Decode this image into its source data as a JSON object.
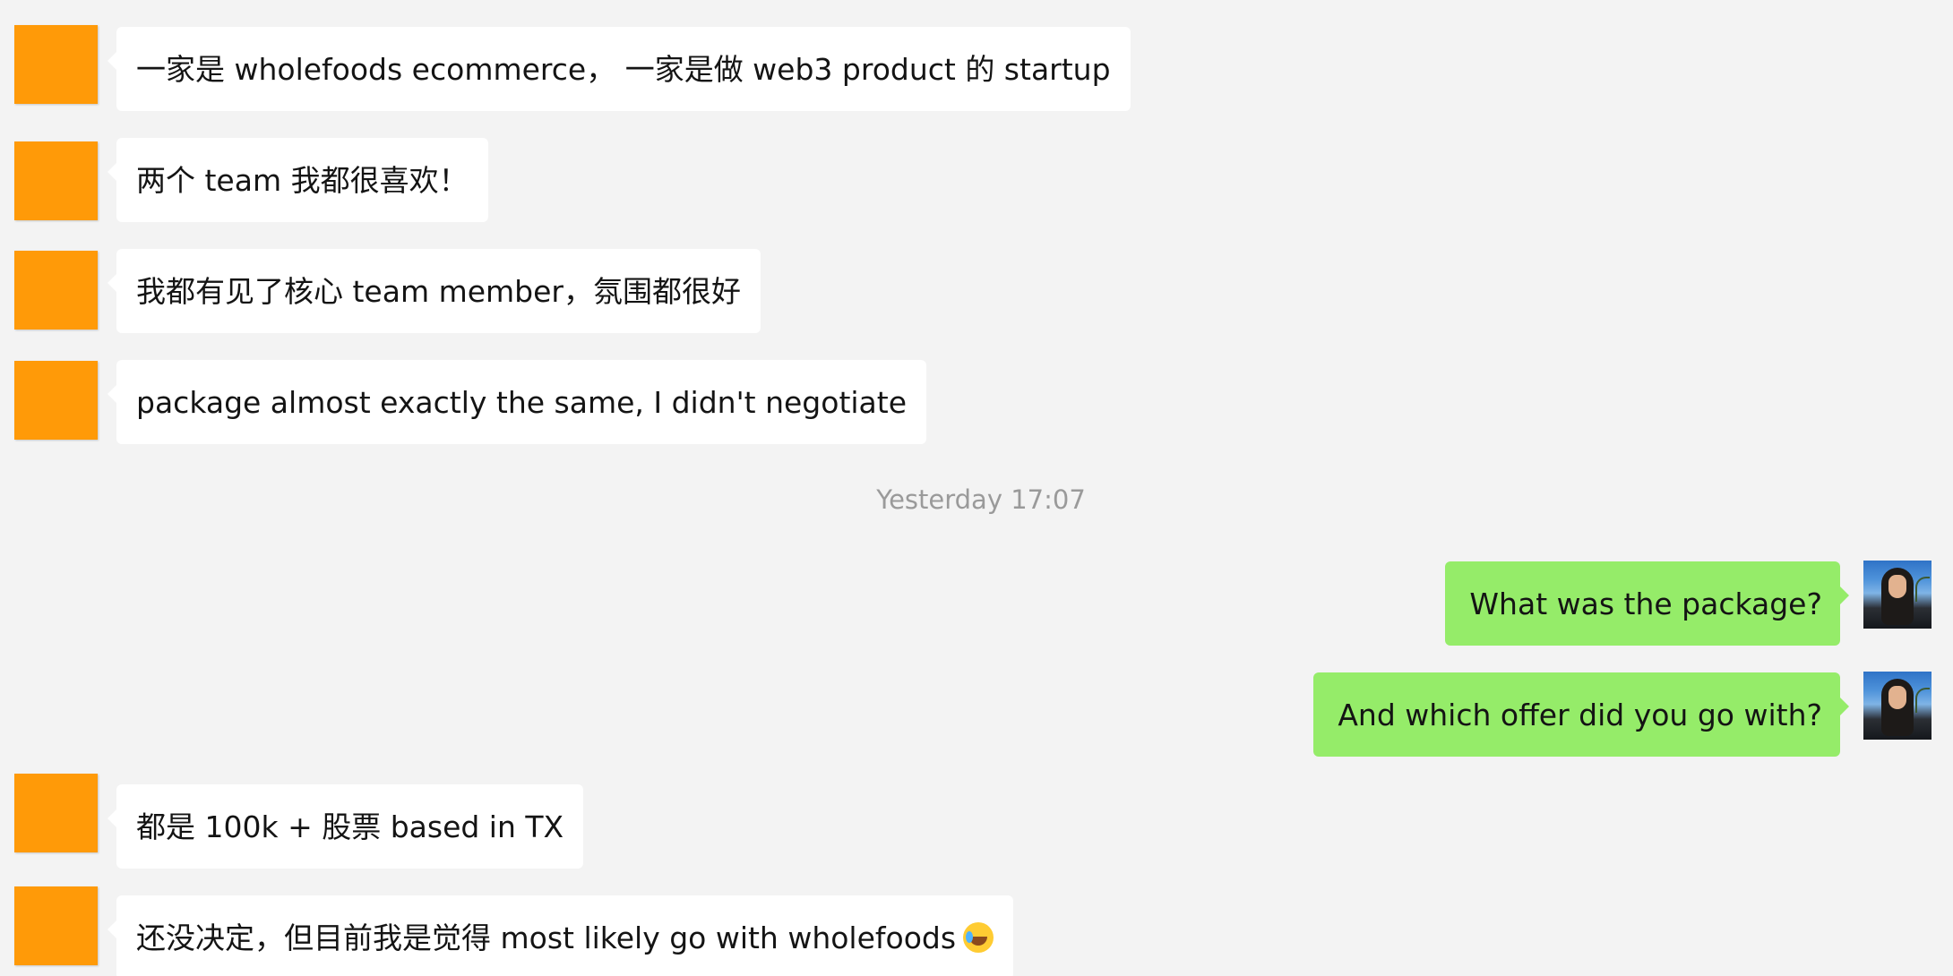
{
  "messages": [
    {
      "side": "left",
      "text": "一家是 wholefoods ecommerce， 一家是做 web3 product 的 startup"
    },
    {
      "side": "left",
      "text": "两个 team 我都很喜欢！"
    },
    {
      "side": "left",
      "text": "我都有见了核心 team member，氛围都很好"
    },
    {
      "side": "left",
      "text": "package almost exactly the same, I didn't negotiate"
    },
    {
      "side": "right",
      "text": "What was the package?"
    },
    {
      "side": "right",
      "text": "And which offer did you go with?"
    },
    {
      "side": "left",
      "text": "都是 100k + 股票 based in TX"
    },
    {
      "side": "left",
      "text": "还没决定，但目前我是觉得 most likely go with wholefoods",
      "emoji": "crying-laughing-emoji"
    }
  ],
  "timestamp": "Yesterday 17:07",
  "colors": {
    "background": "#f3f3f3",
    "left_bubble": "#ffffff",
    "right_bubble": "#95ec69",
    "contact_avatar": "#ff9a08"
  }
}
